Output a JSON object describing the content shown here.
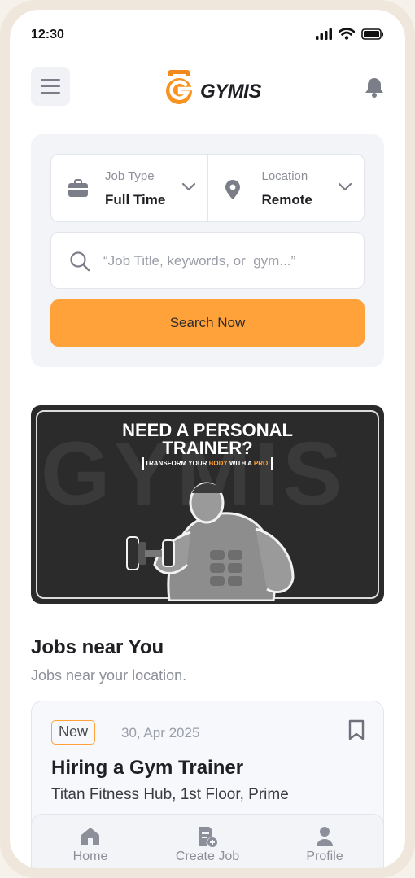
{
  "status_bar": {
    "time": "12:30"
  },
  "header": {
    "brand": "GYMIS"
  },
  "search": {
    "job_type_label": "Job Type",
    "job_type_value": "Full Time",
    "location_label": "Location",
    "location_value": "Remote",
    "placeholder": "“Job Title, keywords, or  gym...”",
    "button_label": "Search Now"
  },
  "banner": {
    "background_text": "GYMIS",
    "title_line1": "NEED A PERSONAL",
    "title_line2": "TRAINER?",
    "tag_part1": "TRANSFORM YOUR ",
    "tag_highlight1": "BODY",
    "tag_part2": " WITH A ",
    "tag_highlight2": "PRO!"
  },
  "section": {
    "title": "Jobs near You",
    "subtitle": "Jobs near your location."
  },
  "job": {
    "badge": "New",
    "date": "30, Apr 2025",
    "title": "Hiring a Gym Trainer",
    "company": "Titan Fitness Hub, 1st Floor, Prime"
  },
  "nav": {
    "home": "Home",
    "create_job": "Create Job",
    "profile": "Profile"
  },
  "colors": {
    "accent": "#ffa23a",
    "brand_dark": "#1f1f24",
    "muted": "#8c8f99"
  }
}
